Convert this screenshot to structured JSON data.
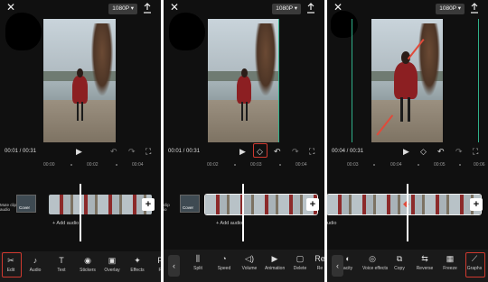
{
  "panels": [
    {
      "resolution": "1080P",
      "time_current": "00:01",
      "time_total": "00:31",
      "ruler_ticks": [
        "00:00",
        "00:02",
        "00:04"
      ],
      "cover_label": "Cover",
      "left_text": "Mute clip\naudio",
      "add_audio": "+ Add audio",
      "tools": [
        {
          "icon": "✂",
          "label": "Edit",
          "highlight": true
        },
        {
          "icon": "♪",
          "label": "Audio"
        },
        {
          "icon": "T",
          "label": "Text"
        },
        {
          "icon": "◉",
          "label": "Stickers"
        },
        {
          "icon": "▣",
          "label": "Overlay"
        },
        {
          "icon": "✦",
          "label": "Effects"
        },
        {
          "icon": "F",
          "label": "F"
        }
      ]
    },
    {
      "resolution": "1080P",
      "time_current": "00:01",
      "time_total": "00:31",
      "ruler_ticks": [
        "00:02",
        "00:03",
        "00:04"
      ],
      "cover_label": "Cover",
      "left_text": "clip\nio",
      "add_audio": "+ Add audio",
      "tools": [
        {
          "icon": "⫼",
          "label": "Split"
        },
        {
          "icon": "◔",
          "label": "Speed"
        },
        {
          "icon": "◁)",
          "label": "Volume"
        },
        {
          "icon": "▶",
          "label": "Animation"
        },
        {
          "icon": "▢",
          "label": "Delete"
        },
        {
          "icon": "Re",
          "label": "Re"
        }
      ]
    },
    {
      "resolution": "1080P",
      "time_current": "00:04",
      "time_total": "00:31",
      "ruler_ticks": [
        "00:03",
        "00:04",
        "00:05",
        "00:06"
      ],
      "add_audio": "udio",
      "tools": [
        {
          "icon": "◐",
          "label": "acity"
        },
        {
          "icon": "◎",
          "label": "Voice effects"
        },
        {
          "icon": "⧉",
          "label": "Copy"
        },
        {
          "icon": "⇆",
          "label": "Reverse"
        },
        {
          "icon": "▦",
          "label": "Freeze"
        },
        {
          "icon": "⟋",
          "label": "Graphs",
          "highlight": true
        }
      ]
    }
  ],
  "colors": {
    "background": "#101010",
    "toolbar": "#1a1a1a",
    "highlight": "#d0392f",
    "accent_line": "#2fb08a"
  }
}
